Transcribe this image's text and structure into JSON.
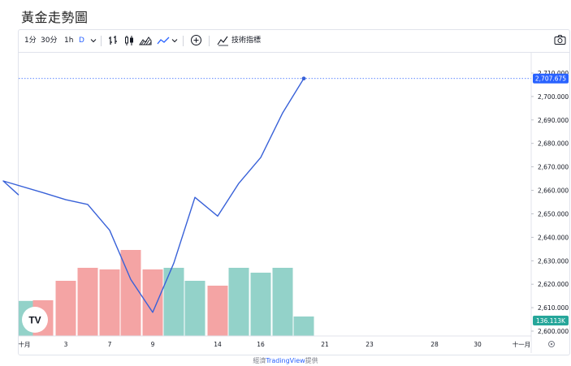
{
  "page": {
    "title": "黃金走勢圖"
  },
  "toolbar": {
    "intervals": [
      "1分",
      "30分",
      "1h",
      "D"
    ],
    "active_interval": "D",
    "indicators_label": "技術指標",
    "icons": [
      "chevron-down-icon",
      "bar-chart-icon",
      "candlestick-icon",
      "area-chart-icon",
      "line-chart-icon",
      "add-compare-icon",
      "indicators-icon",
      "camera-icon"
    ]
  },
  "chart_data": {
    "type": "line",
    "title": "",
    "xlabel": "",
    "ylabel": "",
    "price_series": [
      {
        "x": "10-01",
        "y": 2658
      },
      {
        "x": "10-01",
        "y": 2664
      },
      {
        "x": "10-02",
        "y": 2659
      },
      {
        "x": "10-03",
        "y": 2656
      },
      {
        "x": "10-04",
        "y": 2654
      },
      {
        "x": "10-07",
        "y": 2643
      },
      {
        "x": "10-08",
        "y": 2622
      },
      {
        "x": "10-09",
        "y": 2608
      },
      {
        "x": "10-10",
        "y": 2629
      },
      {
        "x": "10-11",
        "y": 2657
      },
      {
        "x": "10-14",
        "y": 2649
      },
      {
        "x": "10-15",
        "y": 2663
      },
      {
        "x": "10-16",
        "y": 2674
      },
      {
        "x": "10-17",
        "y": 2693
      },
      {
        "x": "10-18",
        "y": 2707.675
      }
    ],
    "volume_series": [
      {
        "x": "10-01",
        "value": 108,
        "direction": "up"
      },
      {
        "x": "10-02",
        "value": 110,
        "direction": "down"
      },
      {
        "x": "10-03",
        "value": 170,
        "direction": "down"
      },
      {
        "x": "10-04",
        "value": 210,
        "direction": "down"
      },
      {
        "x": "10-07",
        "value": 205,
        "direction": "down"
      },
      {
        "x": "10-08",
        "value": 265,
        "direction": "down"
      },
      {
        "x": "10-09",
        "value": 205,
        "direction": "down"
      },
      {
        "x": "10-10",
        "value": 210,
        "direction": "up"
      },
      {
        "x": "10-11",
        "value": 170,
        "direction": "up"
      },
      {
        "x": "10-14",
        "value": 155,
        "direction": "down"
      },
      {
        "x": "10-15",
        "value": 210,
        "direction": "up"
      },
      {
        "x": "10-16",
        "value": 195,
        "direction": "up"
      },
      {
        "x": "10-17",
        "value": 210,
        "direction": "up"
      },
      {
        "x": "10-18",
        "value": 60,
        "direction": "up"
      }
    ],
    "y_ticks": [
      "2,600.000",
      "2,610.000",
      "2,620.000",
      "2,630.000",
      "2,640.000",
      "2,650.000",
      "2,660.000",
      "2,670.000",
      "2,680.000",
      "2,690.000",
      "2,700.000",
      "2,710.000"
    ],
    "ylim": [
      2598,
      2712
    ],
    "x_ticks": [
      {
        "label": "十月",
        "date": "10-01"
      },
      {
        "label": "3",
        "date": "10-03"
      },
      {
        "label": "7",
        "date": "10-07"
      },
      {
        "label": "9",
        "date": "10-09"
      },
      {
        "label": "14",
        "date": "10-14"
      },
      {
        "label": "16",
        "date": "10-16"
      },
      {
        "label": "21",
        "date": "10-21"
      },
      {
        "label": "23",
        "date": "10-23"
      },
      {
        "label": "28",
        "date": "10-28"
      },
      {
        "label": "30",
        "date": "10-30"
      },
      {
        "label": "十一月",
        "date": "11-01"
      }
    ],
    "last_price_label": "2,707.675",
    "volume_label": "136.113K",
    "grid": false,
    "colors": {
      "line": "#3861d8",
      "up": "#93d2c9",
      "down": "#f4a4a4",
      "price_label_bg": "#2962ff",
      "volume_label_bg": "#26a69a"
    }
  },
  "watermark": {
    "text": "TV"
  },
  "footer": {
    "prefix": "經濟",
    "link": "TradingView",
    "suffix": "提供"
  }
}
